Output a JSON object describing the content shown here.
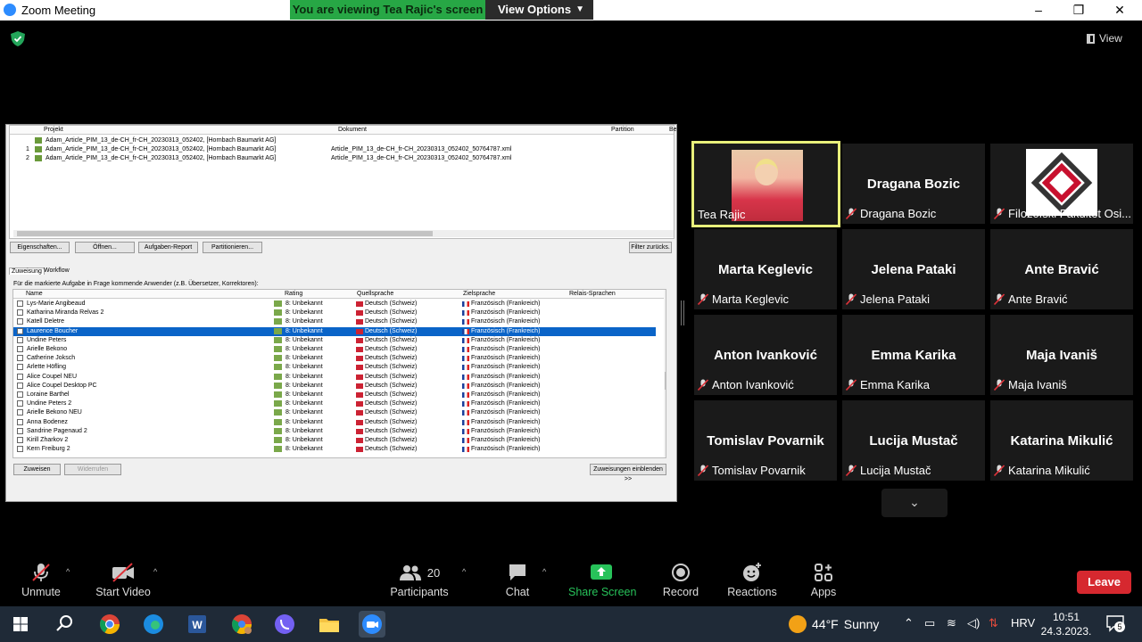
{
  "window": {
    "title": "Zoom Meeting",
    "banner_text": "You are viewing Tea Rajic's screen",
    "view_options": "View Options",
    "minimize": "–",
    "restore": "❐",
    "close": "✕",
    "view_label": "View"
  },
  "shared_screen": {
    "top_header": {
      "projekt": "Projekt",
      "dokument": "Dokument",
      "partition": "Partition",
      "be": "Be"
    },
    "top_rows": [
      {
        "num": "",
        "projekt": "Adam_Article_PIM_13_de-CH_fr-CH_20230313_052402, [Hornbach Baumarkt AG]",
        "dokument": ""
      },
      {
        "num": "1",
        "projekt": "Adam_Article_PIM_13_de-CH_fr-CH_20230313_052402, [Hornbach Baumarkt AG]",
        "dokument": "Article_PIM_13_de-CH_fr-CH_20230313_052402_50764787.xml"
      },
      {
        "num": "2",
        "projekt": "Adam_Article_PIM_13_de-CH_fr-CH_20230313_052402, [Hornbach Baumarkt AG]",
        "dokument": "Article_PIM_13_de-CH_fr-CH_20230313_052402_50764787.xml"
      }
    ],
    "buttons": {
      "eigenschaften": "Eigenschaften...",
      "oeffnen": "Öffnen...",
      "aufgaben_report": "Aufgaben-Report",
      "partitionieren": "Partitionieren...",
      "filter_zuruecks": "Filter zurücks."
    },
    "tabs": {
      "zuweisung": "Zuweisung",
      "workflow": "Workflow"
    },
    "instruction": "Für die markierte Aufgabe in Frage kommende Anwender (z.B. Übersetzer, Korrektoren):",
    "assign_header": {
      "name": "Name",
      "rating": "Rating",
      "quellsprache": "Quellsprache",
      "zielsprache": "Zielsprache",
      "relais": "Relais-Sprachen"
    },
    "assign_rows": [
      {
        "name": "Lys-Marie Angibeaud",
        "rating": "8: Unbekannt",
        "quelle": "Deutsch (Schweiz)",
        "ziel": "Französisch (Frankreich)"
      },
      {
        "name": "Katharina Miranda Relvas 2",
        "rating": "8: Unbekannt",
        "quelle": "Deutsch (Schweiz)",
        "ziel": "Französisch (Frankreich)"
      },
      {
        "name": "Katell Deletre",
        "rating": "8: Unbekannt",
        "quelle": "Deutsch (Schweiz)",
        "ziel": "Französisch (Frankreich)"
      },
      {
        "name": "Laurence Boucher",
        "rating": "8: Unbekannt",
        "quelle": "Deutsch (Schweiz)",
        "ziel": "Französisch (Frankreich)",
        "selected": true
      },
      {
        "name": "Undine Peters",
        "rating": "8: Unbekannt",
        "quelle": "Deutsch (Schweiz)",
        "ziel": "Französisch (Frankreich)"
      },
      {
        "name": "Arielle Bekono",
        "rating": "8: Unbekannt",
        "quelle": "Deutsch (Schweiz)",
        "ziel": "Französisch (Frankreich)"
      },
      {
        "name": "Catherine Joksch",
        "rating": "8: Unbekannt",
        "quelle": "Deutsch (Schweiz)",
        "ziel": "Französisch (Frankreich)"
      },
      {
        "name": "Arlette Höfling",
        "rating": "8: Unbekannt",
        "quelle": "Deutsch (Schweiz)",
        "ziel": "Französisch (Frankreich)"
      },
      {
        "name": "Alice Coupel NEU",
        "rating": "8: Unbekannt",
        "quelle": "Deutsch (Schweiz)",
        "ziel": "Französisch (Frankreich)"
      },
      {
        "name": "Alice Coupel Desktop PC",
        "rating": "8: Unbekannt",
        "quelle": "Deutsch (Schweiz)",
        "ziel": "Französisch (Frankreich)"
      },
      {
        "name": "Loraine Barthel",
        "rating": "8: Unbekannt",
        "quelle": "Deutsch (Schweiz)",
        "ziel": "Französisch (Frankreich)"
      },
      {
        "name": "Undine Peters 2",
        "rating": "8: Unbekannt",
        "quelle": "Deutsch (Schweiz)",
        "ziel": "Französisch (Frankreich)"
      },
      {
        "name": "Arielle Bekono NEU",
        "rating": "8: Unbekannt",
        "quelle": "Deutsch (Schweiz)",
        "ziel": "Französisch (Frankreich)"
      },
      {
        "name": "Anna Bodenez",
        "rating": "8: Unbekannt",
        "quelle": "Deutsch (Schweiz)",
        "ziel": "Französisch (Frankreich)"
      },
      {
        "name": "Sandrine Pagenaud 2",
        "rating": "8: Unbekannt",
        "quelle": "Deutsch (Schweiz)",
        "ziel": "Französisch (Frankreich)"
      },
      {
        "name": "Kirill Zharkov 2",
        "rating": "8: Unbekannt",
        "quelle": "Deutsch (Schweiz)",
        "ziel": "Französisch (Frankreich)"
      },
      {
        "name": "Kern Freiburg 2",
        "rating": "8: Unbekannt",
        "quelle": "Deutsch (Schweiz)",
        "ziel": "Französisch (Frankreich)"
      }
    ],
    "bottom_buttons": {
      "zuweisen": "Zuweisen",
      "widerrufen": "Widerrufen",
      "einblenden": "Zuweisungen einblenden >>"
    }
  },
  "participants": [
    {
      "big": "",
      "label": "Tea Rajic",
      "active": true,
      "video": true
    },
    {
      "big": "Dragana Bozic",
      "label": "Dragana Bozic"
    },
    {
      "big": "",
      "label": "Filozofski Fakultet Osi...",
      "logo": true
    },
    {
      "big": "Marta Keglevic",
      "label": "Marta Keglevic"
    },
    {
      "big": "Jelena Pataki",
      "label": "Jelena Pataki"
    },
    {
      "big": "Ante Bravić",
      "label": "Ante Bravić"
    },
    {
      "big": "Anton Ivanković",
      "label": "Anton Ivanković"
    },
    {
      "big": "Emma Karika",
      "label": "Emma Karika"
    },
    {
      "big": "Maja Ivaniš",
      "label": "Maja Ivaniš"
    },
    {
      "big": "Tomislav Povarnik",
      "label": "Tomislav Povarnik"
    },
    {
      "big": "Lucija Mustač",
      "label": "Lucija Mustač"
    },
    {
      "big": "Katarina Mikulić",
      "label": "Katarina Mikulić"
    }
  ],
  "toolbar": {
    "unmute": "Unmute",
    "start_video": "Start Video",
    "participants": "Participants",
    "participant_count": "20",
    "chat": "Chat",
    "share_screen": "Share Screen",
    "record": "Record",
    "reactions": "Reactions",
    "apps": "Apps",
    "leave": "Leave"
  },
  "taskbar": {
    "temperature": "44°F",
    "weather": "Sunny",
    "language": "HRV",
    "time": "10:51",
    "date": "24.3.2023.",
    "notifications": "5"
  },
  "colors": {
    "banner_green": "#27a745",
    "active_speaker": "#e9f07b",
    "leave_red": "#d6282f",
    "share_green": "#27c25a",
    "selection_blue": "#0a64c8"
  }
}
